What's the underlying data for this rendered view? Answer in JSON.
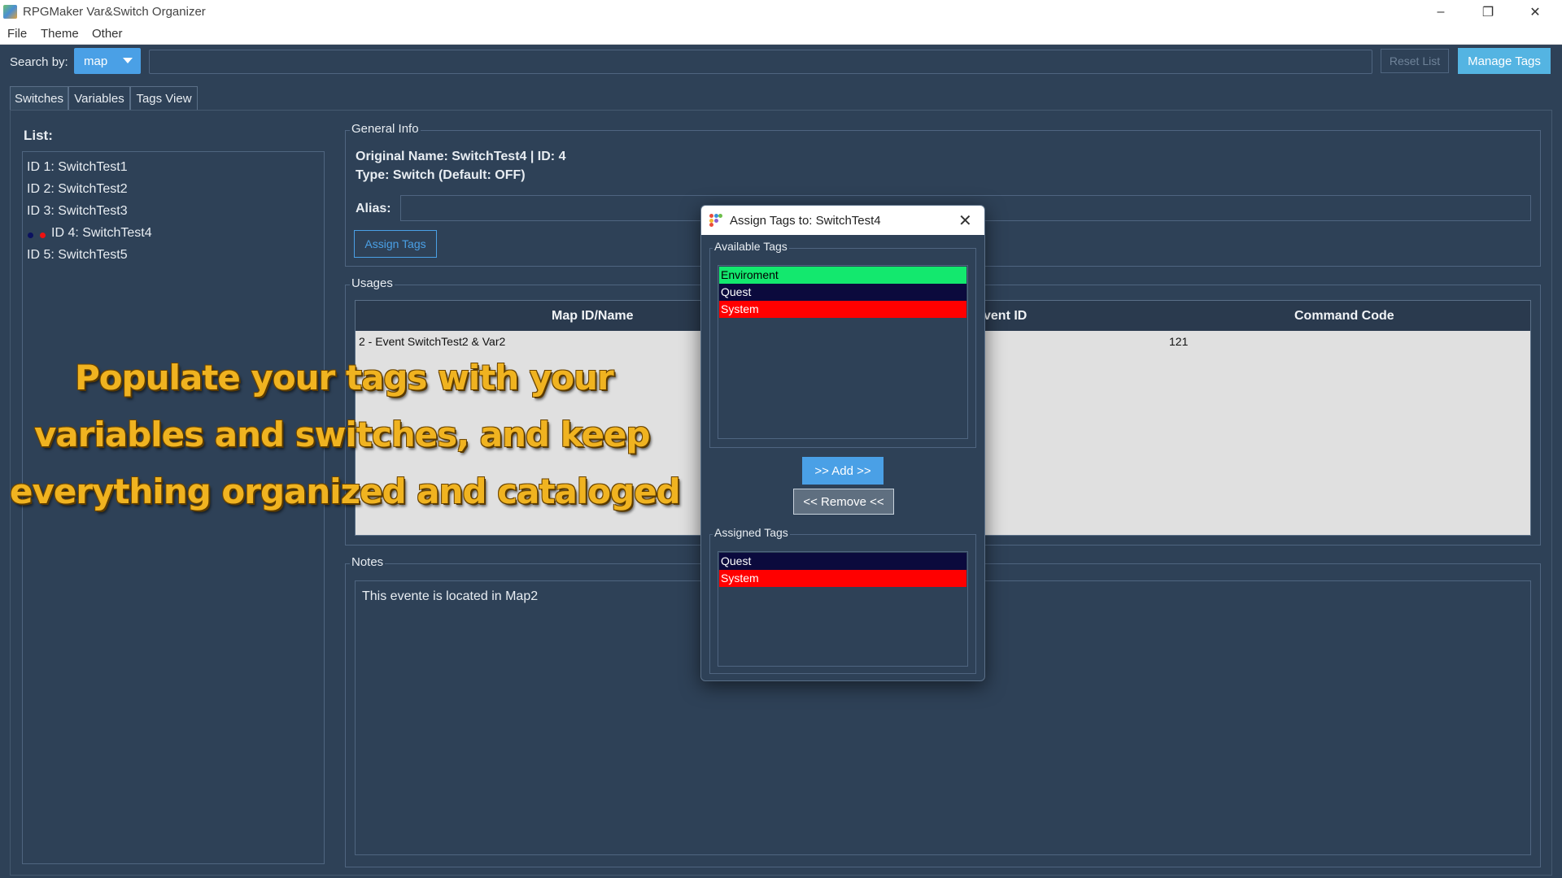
{
  "window": {
    "title": "RPGMaker Var&Switch Organizer",
    "controls": {
      "minimize": "–",
      "restore": "❐",
      "close": "✕"
    }
  },
  "menu": [
    "File",
    "Theme",
    "Other"
  ],
  "search": {
    "label": "Search by:",
    "mode": "map",
    "reset_label": "Reset List",
    "manage_tags_label": "Manage Tags"
  },
  "tabs": [
    "Switches",
    "Variables",
    "Tags View"
  ],
  "list": {
    "label": "List:",
    "items": [
      "ID 1: SwitchTest1",
      "ID 2: SwitchTest2",
      "ID 3: SwitchTest3",
      "ID 4: SwitchTest4",
      "ID 5: SwitchTest5"
    ]
  },
  "general": {
    "title": "General Info",
    "original_name": "Original Name: SwitchTest4 | ID: 4",
    "type": "Type: Switch (Default: OFF)",
    "alias_label": "Alias:",
    "alias_value": "",
    "assign_tags_label": "Assign Tags"
  },
  "usages": {
    "title": "Usages",
    "columns": [
      "Map ID/Name",
      "vent ID",
      "Command Code"
    ],
    "rows": [
      {
        "map": "2 - Event SwitchTest2 & Var2",
        "command_code": "121"
      }
    ]
  },
  "notes": {
    "title": "Notes",
    "text": "This evente is located in Map2"
  },
  "overlay": [
    "Populate your tags with your",
    "variables and switches, and keep",
    "everything organized and cataloged"
  ],
  "dialog": {
    "title": "Assign Tags to: SwitchTest4",
    "close": "✕",
    "available_title": "Available Tags",
    "available_tags": [
      {
        "name": "Enviroment",
        "bg": "#13e86e",
        "fg": "#000000"
      },
      {
        "name": "Quest",
        "bg": "#0b0a3d",
        "fg": "#ffffff"
      },
      {
        "name": "System",
        "bg": "#ff0000",
        "fg": "#ffffff"
      }
    ],
    "add_label": ">> Add >>",
    "remove_label": "<< Remove <<",
    "assigned_title": "Assigned Tags",
    "assigned_tags": [
      {
        "name": "Quest",
        "bg": "#0b0a3d",
        "fg": "#ffffff"
      },
      {
        "name": "System",
        "bg": "#ff0000",
        "fg": "#ffffff"
      }
    ]
  },
  "colors": {
    "background": "#2e4157",
    "accent": "#4aa0e6",
    "overlay_text": "#f0b320"
  }
}
